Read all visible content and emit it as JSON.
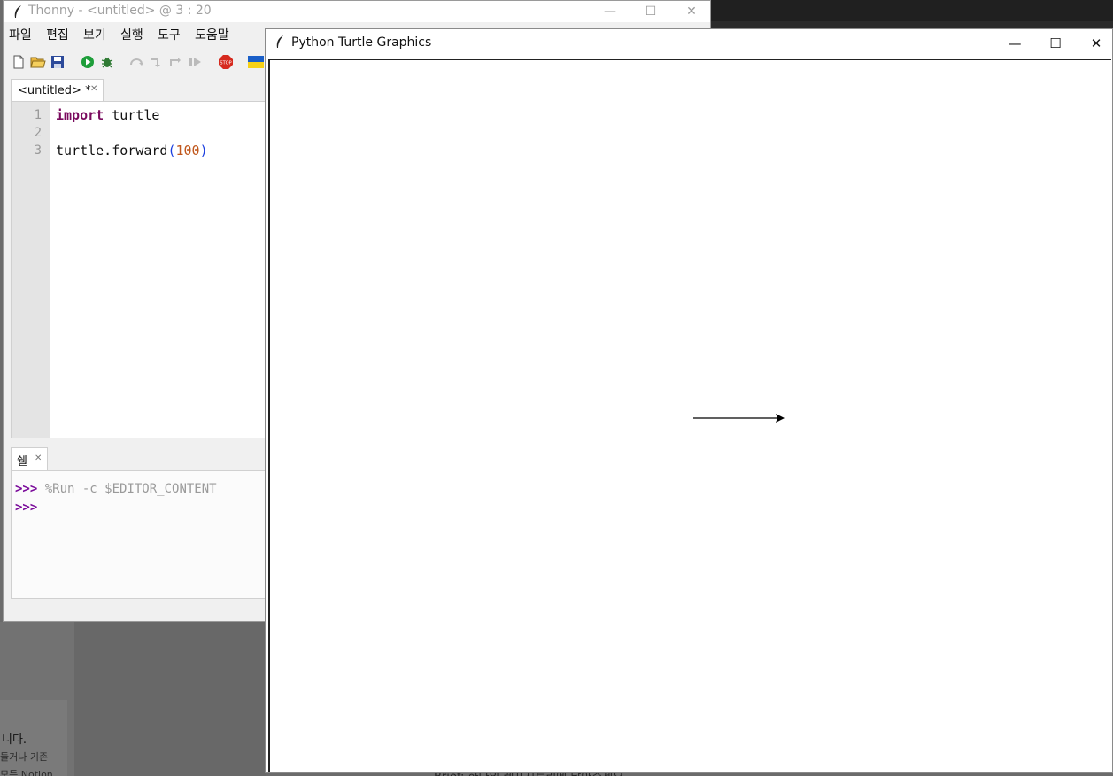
{
  "thonny": {
    "title": "Thonny  -  <untitled>  @  3 : 20",
    "menu": [
      "파일",
      "편집",
      "보기",
      "실행",
      "도구",
      "도움말"
    ],
    "tab_label": "<untitled> *",
    "code": {
      "line_numbers": [
        "1",
        "2",
        "3"
      ],
      "line1_kw": "import",
      "line1_rest": " turtle",
      "line3_obj": "turtle.forward",
      "line3_open": "(",
      "line3_arg": "100",
      "line3_close": ")"
    },
    "shell": {
      "tab_label": "쉘",
      "prompt": ">>>",
      "command": " %Run -c $EDITOR_CONTENT"
    }
  },
  "turtle_window": {
    "title": "Python Turtle Graphics"
  },
  "background": {
    "note_line1": "니다.",
    "note_line2": "들거나 기존",
    "note_line3": "모든 Notion",
    "bottom_text": "Brief: 하나의 레포지토리에 담아주세요"
  },
  "icons": {
    "app": "feather-icon",
    "new": "new-file-icon",
    "open": "open-folder-icon",
    "save": "save-icon",
    "run": "run-icon",
    "debug": "debug-icon",
    "stop": "stop-icon",
    "flag": "ukraine-flag-icon"
  },
  "colors": {
    "keyword": "#7a0a5e",
    "number": "#c0571c",
    "paren": "#1b3fe0",
    "prompt": "#7a0a9a",
    "run_green": "#1e9e3a",
    "stop_red": "#d62a1e"
  }
}
